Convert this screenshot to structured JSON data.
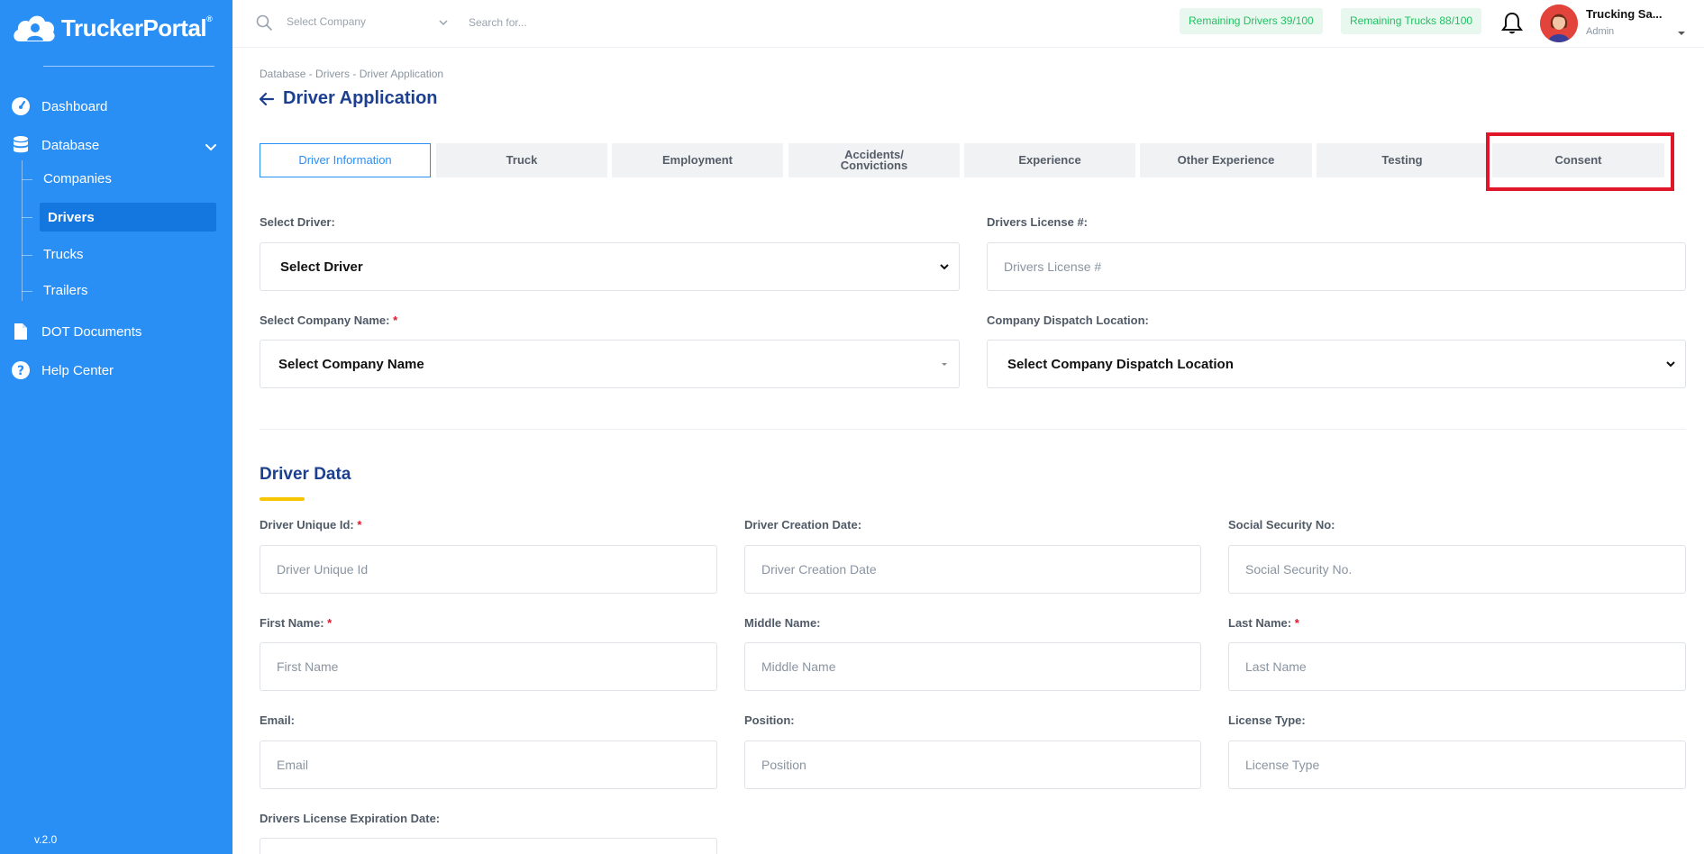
{
  "sidebar": {
    "logo_text": "TruckerPortal",
    "logo_mark": "®",
    "items": {
      "dashboard": "Dashboard",
      "database": "Database",
      "dot_documents": "DOT Documents",
      "help_center": "Help Center"
    },
    "sub_items": {
      "companies": "Companies",
      "drivers": "Drivers",
      "trucks": "Trucks",
      "trailers": "Trailers"
    },
    "active_item": "Drivers",
    "version": "v.2.0"
  },
  "topbar": {
    "company_select": "Select Company",
    "search_placeholder": "Search for...",
    "remaining_drivers": "Remaining Drivers 39/100",
    "remaining_trucks": "Remaining Trucks 88/100",
    "user_name": "Trucking Sa...",
    "user_role": "Admin"
  },
  "page": {
    "breadcrumb": "Database - Drivers - Driver Application",
    "title": "Driver Application"
  },
  "tabs": {
    "driver_information": "Driver Information",
    "truck": "Truck",
    "employment": "Employment",
    "accidents_line1": "Accidents/",
    "accidents_line2": "Convictions",
    "experience": "Experience",
    "other_experience": "Other Experience",
    "testing": "Testing",
    "consent": "Consent",
    "active": "Driver Information",
    "highlighted": "Consent"
  },
  "form": {
    "select_driver_label": "Select Driver:",
    "select_driver_value": "Select Driver",
    "license_label": "Drivers License #:",
    "license_placeholder": "Drivers License #",
    "company_label": "Select Company Name:",
    "company_value": "Select Company Name",
    "dispatch_label": "Company Dispatch Location:",
    "dispatch_value": "Select Company Dispatch Location",
    "required_mark": "*"
  },
  "driver_data": {
    "section_title": "Driver Data",
    "unique_id_label": "Driver Unique Id:",
    "unique_id_placeholder": "Driver Unique Id",
    "creation_date_label": "Driver Creation Date:",
    "creation_date_placeholder": "Driver Creation Date",
    "ssn_label": "Social Security No:",
    "ssn_placeholder": "Social Security No.",
    "first_name_label": "First Name:",
    "first_name_placeholder": "First Name",
    "middle_name_label": "Middle Name:",
    "middle_name_placeholder": "Middle Name",
    "last_name_label": "Last Name:",
    "last_name_placeholder": "Last Name",
    "email_label": "Email:",
    "email_placeholder": "Email",
    "position_label": "Position:",
    "position_placeholder": "Position",
    "license_type_label": "License Type:",
    "license_type_placeholder": "License Type",
    "license_exp_label": "Drivers License Expiration Date:"
  },
  "colors": {
    "sidebar": "#2a8ff5",
    "sidebar_active": "#1476df",
    "title_blue": "#1c3f8f",
    "accent_yellow": "#f7c600",
    "badge_green": "#22c063",
    "highlight_red": "#e0162b"
  },
  "icons": {
    "logo": "cloud-person-icon",
    "dashboard": "speedometer-icon",
    "database": "database-icon",
    "dot_documents": "document-icon",
    "help_center": "question-icon",
    "search": "search-icon",
    "bell": "bell-icon",
    "back": "arrow-left-icon"
  }
}
